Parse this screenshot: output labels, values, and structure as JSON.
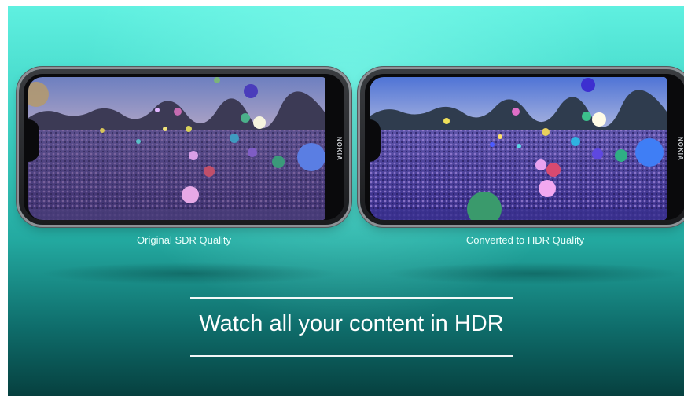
{
  "left_phone": {
    "caption": "Original SDR Quality",
    "brand": "NOKIA"
  },
  "right_phone": {
    "caption": "Converted to HDR Quality",
    "brand": "NOKIA"
  },
  "tagline": "Watch all your content in HDR",
  "colors": {
    "background_top": "#5ff0e0",
    "background_bottom": "#06403f",
    "text": "#ffffff"
  }
}
